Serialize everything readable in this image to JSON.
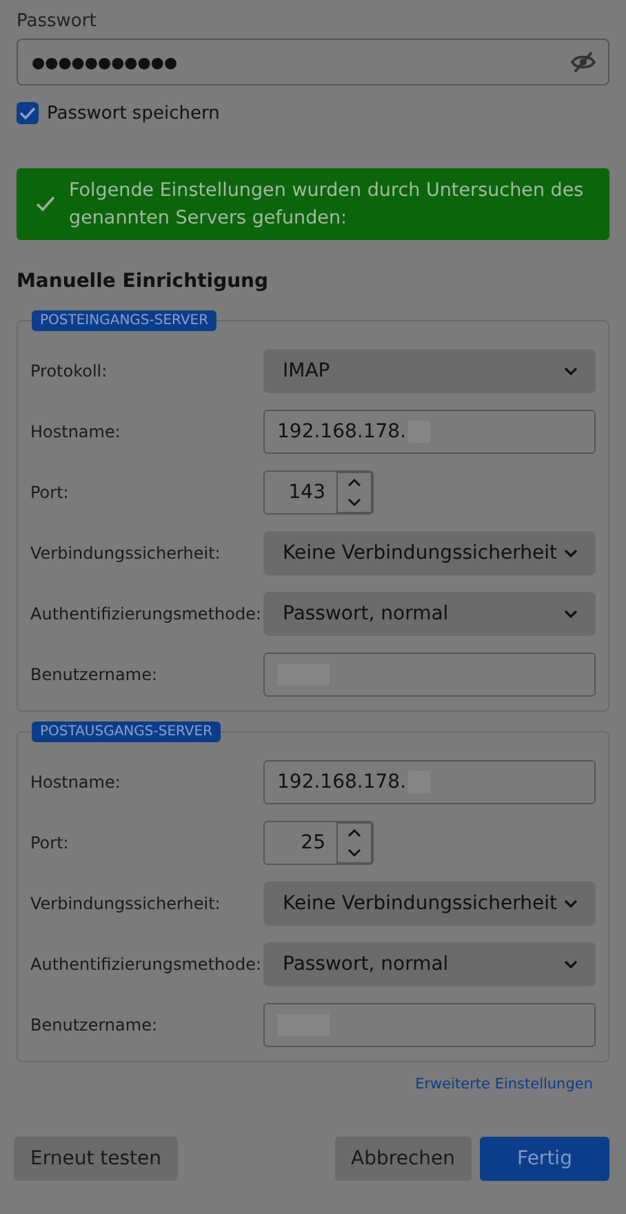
{
  "password": {
    "label": "Passwort",
    "value": "●●●●●●●●●●●"
  },
  "save_password": {
    "label": "Passwort speichern",
    "checked": true
  },
  "notice": {
    "text": "Folgende Einstellungen wurden durch Untersuchen des genannten Servers gefunden:"
  },
  "heading": "Manuelle Einrichtigung",
  "sections": [
    {
      "legend": "POSTEINGANGS-SERVER",
      "rows": [
        {
          "kind": "select",
          "label": "Protokoll:",
          "value": "IMAP"
        },
        {
          "kind": "text",
          "label": "Hostname:",
          "value": "192.168.178.",
          "redacted": true
        },
        {
          "kind": "number",
          "label": "Port:",
          "value": "143"
        },
        {
          "kind": "select",
          "label": "Verbindungssicherheit:",
          "value": "Keine Verbindungssicherheit"
        },
        {
          "kind": "select",
          "label": "Authentifizierungsmethode:",
          "value": "Passwort, normal"
        },
        {
          "kind": "text",
          "label": "Benutzername:",
          "redacted": true
        }
      ]
    },
    {
      "legend": "POSTAUSGANGS-SERVER",
      "rows": [
        {
          "kind": "text",
          "label": "Hostname:",
          "value": "192.168.178.",
          "redacted": true
        },
        {
          "kind": "number",
          "label": "Port:",
          "value": "25"
        },
        {
          "kind": "select",
          "label": "Verbindungssicherheit:",
          "value": "Keine Verbindungssicherheit"
        },
        {
          "kind": "select",
          "label": "Authentifizierungsmethode:",
          "value": "Passwort, normal"
        },
        {
          "kind": "text",
          "label": "Benutzername:",
          "redacted": true
        }
      ]
    }
  ],
  "advanced_link": "Erweiterte Einstellungen",
  "buttons": [
    {
      "label": "Erneut testen",
      "kind": "secondary"
    },
    {
      "label": "Abbrechen",
      "kind": "secondary"
    },
    {
      "label": "Fertig",
      "kind": "primary"
    }
  ]
}
